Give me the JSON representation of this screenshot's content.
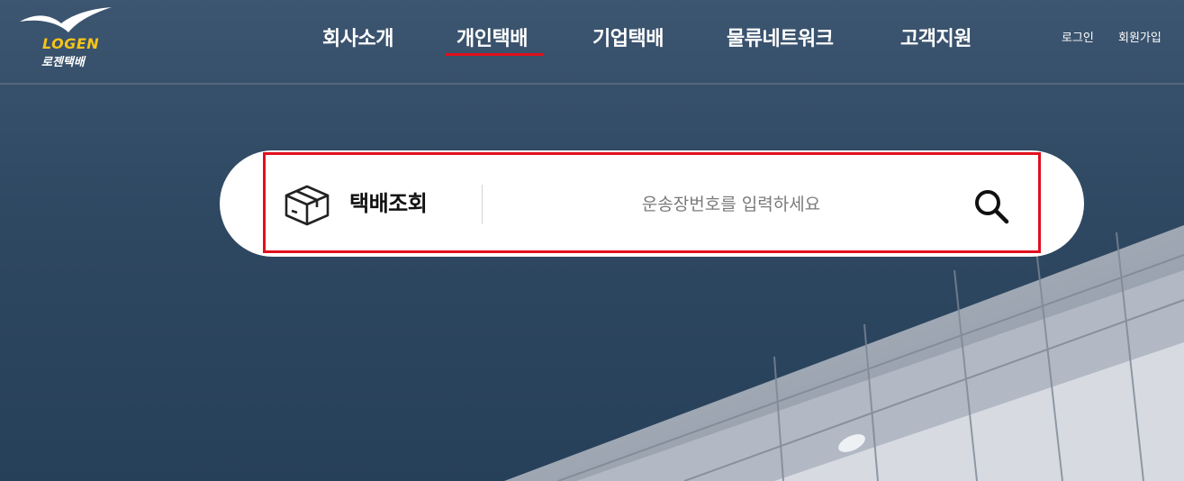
{
  "logo": {
    "text_en": "LOGEN",
    "text_ko": "로젠택배",
    "icon": "seagull-logo-icon"
  },
  "nav": {
    "items": [
      {
        "label": "회사소개"
      },
      {
        "label": "개인택배",
        "active": true
      },
      {
        "label": "기업택배"
      },
      {
        "label": "물류네트워크"
      },
      {
        "label": "고객지원"
      }
    ]
  },
  "util": {
    "login": "로그인",
    "signup": "회원가입"
  },
  "search": {
    "label": "택배조회",
    "placeholder": "운송장번호를 입력하세요",
    "icon": "package-box-icon",
    "button_icon": "search-icon"
  },
  "colors": {
    "accent": "#e0101d",
    "brand_yellow": "#f6c419",
    "background": "#2f4862"
  }
}
